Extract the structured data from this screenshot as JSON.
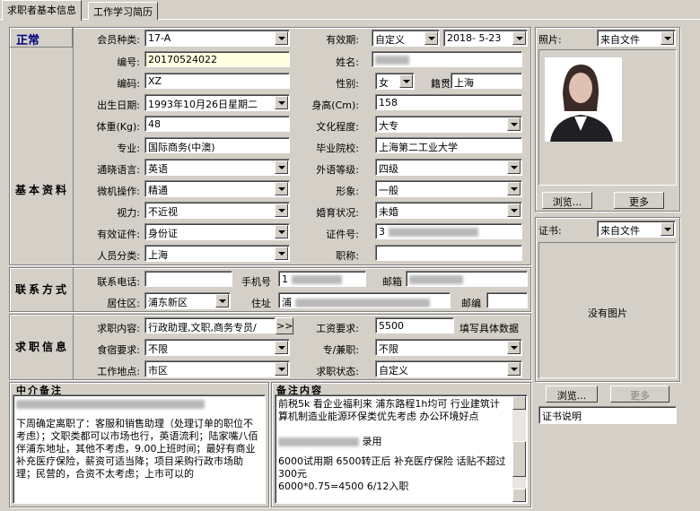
{
  "tabs": [
    {
      "label": "求职者基本信息"
    },
    {
      "label": "工作学习简历"
    }
  ],
  "status": "正常",
  "member": {
    "label": "会员种类:",
    "value": "17-A"
  },
  "validity": {
    "label": "有效期:",
    "mode": "自定义",
    "date": "2018- 5-23"
  },
  "photo": {
    "label": "照片:",
    "source": "来自文件",
    "browse": "浏览...",
    "more": "更多"
  },
  "cert": {
    "label": "证书:",
    "source": "来自文件",
    "no_image": "没有图片",
    "browse": "浏览...",
    "more": "更多",
    "desc": "证书说明"
  },
  "basic": {
    "section": "基本资料",
    "code": {
      "label": "编号:",
      "value": "20170524022"
    },
    "name": {
      "label": "姓名:"
    },
    "code2": {
      "label": "编码:",
      "value": "XZ"
    },
    "gender": {
      "label": "性别:",
      "value": "女"
    },
    "native": {
      "label": "籍贯",
      "value": "上海"
    },
    "birth": {
      "label": "出生日期:",
      "value": "1993年10月26日星期二"
    },
    "height": {
      "label": "身高(Cm):",
      "value": "158"
    },
    "weight": {
      "label": "体重(Kg):",
      "value": "48"
    },
    "edu": {
      "label": "文化程度:",
      "value": "大专"
    },
    "major": {
      "label": "专业:",
      "value": "国际商务(中澳)"
    },
    "school": {
      "label": "毕业院校:",
      "value": "上海第二工业大学"
    },
    "lang": {
      "label": "通晓语言:",
      "value": "英语"
    },
    "lang_level": {
      "label": "外语等级:",
      "value": "四级"
    },
    "pc": {
      "label": "微机操作:",
      "value": "精通"
    },
    "image": {
      "label": "形象:",
      "value": "一般"
    },
    "vision": {
      "label": "视力:",
      "value": "不近视"
    },
    "marital": {
      "label": "婚育状况:",
      "value": "未婚"
    },
    "id_type": {
      "label": "有效证件:",
      "value": "身份证"
    },
    "id_no": {
      "label": "证件号:",
      "value": "3"
    },
    "category": {
      "label": "人员分类:",
      "value": "上海"
    },
    "title": {
      "label": "职称:",
      "value": ""
    }
  },
  "contact": {
    "section": "联系方式",
    "phone": {
      "label": "联系电话:",
      "value": ""
    },
    "mobile": {
      "label": "手机号",
      "value": "1"
    },
    "email": {
      "label": "邮箱",
      "value": ""
    },
    "district": {
      "label": "居住区:",
      "value": "浦东新区"
    },
    "address": {
      "label": "住址",
      "value": "浦"
    },
    "zip": {
      "label": "邮编",
      "value": ""
    }
  },
  "job": {
    "section": "求职信息",
    "want": {
      "label": "求职内容:",
      "value": "行政助理,文职,商务专员/",
      "btn": ">>"
    },
    "salary": {
      "label": "工资要求:",
      "value": "5500",
      "hint": "填写具体数据"
    },
    "board": {
      "label": "食宿要求:",
      "value": "不限"
    },
    "parttime": {
      "label": "专/兼职:",
      "value": "不限"
    },
    "location": {
      "label": "工作地点:",
      "value": "市区"
    },
    "state": {
      "label": "求职状态:",
      "value": "自定义"
    }
  },
  "agent_note": {
    "title": "中介备注",
    "text": "下周确定离职了：客服和销售助理（处理订单的职位不考虑）；文职类都可以市场也行，英语流利；陆家嘴八佰伴浦东地址，其他不考虑，9.00上班时间；最好有商业补充医疗保险，薪资可适当降；项目采购行政市场助理；民营的，合资不太考虑；上市可以的"
  },
  "remark": {
    "title": "备注内容",
    "lines": [
      "前税5k 看企业福利来 浦东路程1h均可 行业建筑计算机制造业能源环保类优先考虑 办公环境好点",
      "录用",
      "6000试用期 6500转正后 补充医疗保险  话贴不超过300元",
      "6000*0.75=4500  6/12入职"
    ]
  }
}
